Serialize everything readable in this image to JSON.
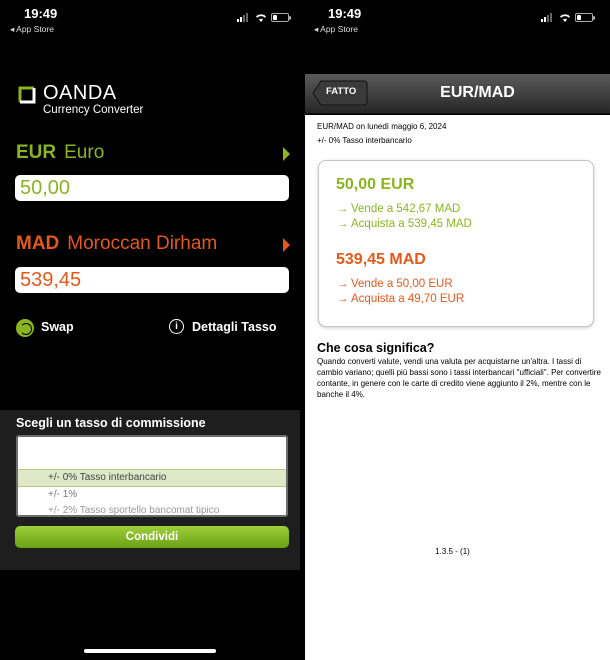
{
  "left": {
    "status": {
      "time": "19:49",
      "back": "◂ App Store"
    },
    "logo": {
      "brand": "OANDA",
      "subtitle": "Currency Converter"
    },
    "from_currency": {
      "code": "EUR",
      "name": "Euro",
      "amount": "50,00"
    },
    "to_currency": {
      "code": "MAD",
      "name": "Moroccan Dirham",
      "amount": "539,45"
    },
    "actions": {
      "swap_label": "Swap",
      "details_label": "Dettagli Tasso",
      "info_glyph": "i"
    },
    "commission": {
      "title": "Scegli un tasso di commissione",
      "options": [
        "+/- 0% Tasso interbancario",
        "+/- 1%",
        "+/- 2% Tasso sportello bancomat tipico"
      ]
    },
    "share_label": "Condividi"
  },
  "right": {
    "status": {
      "time": "19:49",
      "back": "◂ App Store"
    },
    "nav": {
      "done_label": "FATTO",
      "title": "EUR/MAD"
    },
    "meta": {
      "date_line": "EUR/MAD on lunedì maggio 6, 2024",
      "rate_type": "+/- 0% Tasso interbancario"
    },
    "card": {
      "base_main": "50,00  EUR",
      "base_sell": "Vende a 542,67  MAD",
      "base_buy": "Acquista a 539,45  MAD",
      "quote_main": "539,45  MAD",
      "quote_sell": "Vende a 50,00  EUR",
      "quote_buy": "Acquista a 49,70  EUR",
      "arrow_glyph": "→"
    },
    "explanation": {
      "title": "Che cosa significa?",
      "body": "Quando converti valute, vendi una valuta per acquistarne un'altra. I tassi di cambio variano; quelli più bassi sono i tassi interbancari \"ufficiali\". Per convertire contante, in genere con le carte di credito viene aggiunto il 2%, mentre con le banche il 4%."
    },
    "version": "1.3.5 - (1)"
  },
  "colors": {
    "green": "#8ab521",
    "orange": "#e3591a",
    "nav_dark": "#262626"
  },
  "icons": [
    "oanda-logo-icon",
    "chevron-right-icon",
    "swap-icon",
    "info-icon",
    "signal-icon",
    "wifi-icon",
    "battery-icon",
    "arrow-right-icon"
  ]
}
